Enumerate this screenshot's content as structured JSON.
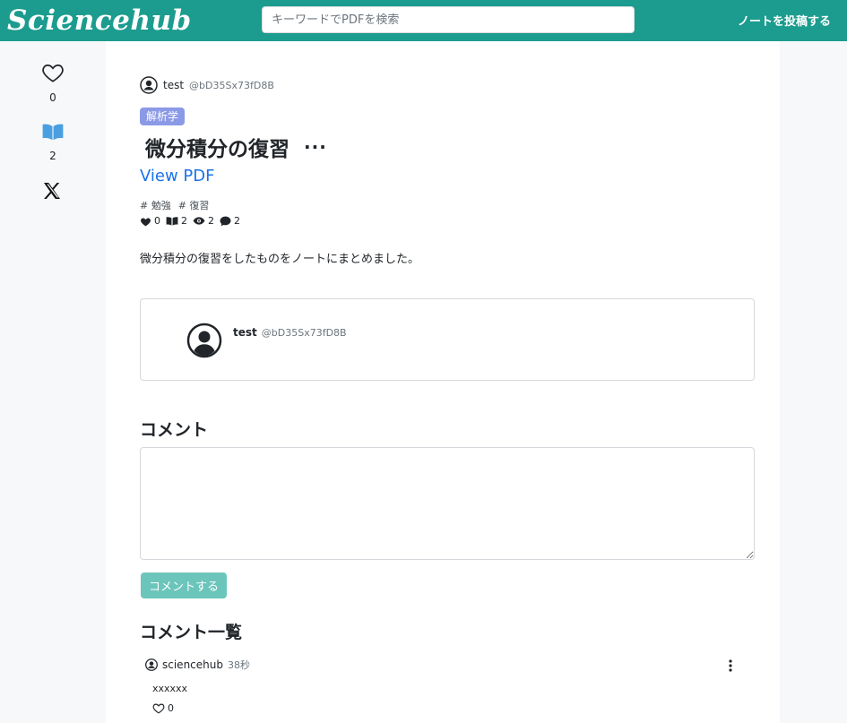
{
  "header": {
    "logo": "Sciencehub",
    "search_placeholder": "キーワードでPDFを検索",
    "post_link": "ノートを投稿する"
  },
  "rail": {
    "like_count": "0",
    "bookmark_count": "2"
  },
  "note": {
    "author_name": "test",
    "author_id": "@bD35Sx73fD8B",
    "category": "解析学",
    "title": "微分積分の復習",
    "more": "···",
    "view_pdf": "View PDF",
    "tags": [
      "# 勉強",
      "# 復習"
    ],
    "stats": {
      "likes": "0",
      "bookmarks": "2",
      "views": "2",
      "comments": "2"
    },
    "description": "微分積分の復習をしたものをノートにまとめました。"
  },
  "profile_card": {
    "name": "test",
    "id": "@bD35Sx73fD8B"
  },
  "comments": {
    "heading": "コメント",
    "submit_label": "コメントする",
    "list_heading": "コメント一覧",
    "items": [
      {
        "user": "sciencehub",
        "time": "38秒",
        "body": "xxxxxx",
        "likes": "0"
      }
    ]
  },
  "colors": {
    "header_bg": "#1b9c8e",
    "submit_bg": "#6cc5bb",
    "category_bg": "#8b9ae6",
    "link": "#1a73e8",
    "bookmark_icon": "#4a9fe0"
  }
}
